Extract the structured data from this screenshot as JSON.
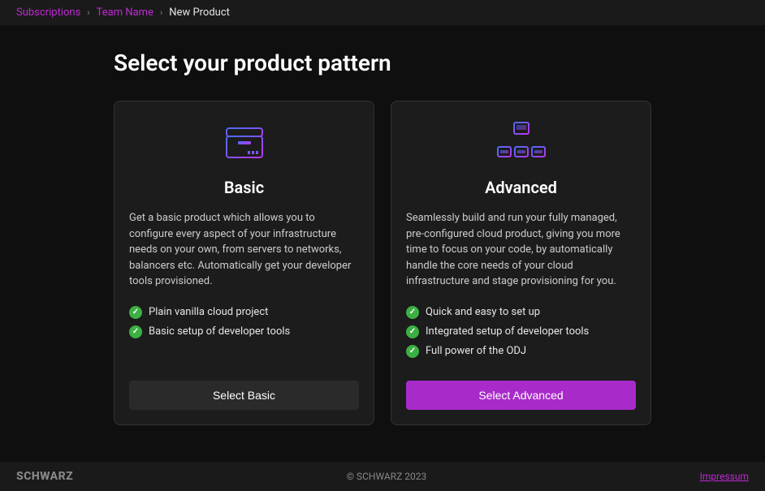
{
  "breadcrumb": {
    "items": [
      {
        "label": "Subscriptions",
        "link": true
      },
      {
        "label": "Team Name",
        "link": true
      },
      {
        "label": "New Product",
        "link": false
      }
    ]
  },
  "page": {
    "title": "Select your product pattern"
  },
  "cards": {
    "basic": {
      "title": "Basic",
      "description": "Get a basic product which allows you to configure every aspect of your infrastructure needs on your own, from servers to networks, balancers etc. Automatically get your developer tools provisioned.",
      "features": [
        "Plain vanilla cloud project",
        "Basic setup of developer tools"
      ],
      "button": "Select Basic"
    },
    "advanced": {
      "title": "Advanced",
      "description": "Seamlessly build and run your fully managed, pre-configured cloud product, giving you more time to focus on your code, by automatically handle the core needs of your cloud infrastructure and stage provisioning for you.",
      "features": [
        "Quick and easy to set up",
        "Integrated setup of developer tools",
        "Full power of the ODJ"
      ],
      "button": "Select Advanced"
    }
  },
  "footer": {
    "brand": "SCHWARZ",
    "copyright": "© SCHWARZ 2023",
    "impressum": "Impressum"
  }
}
